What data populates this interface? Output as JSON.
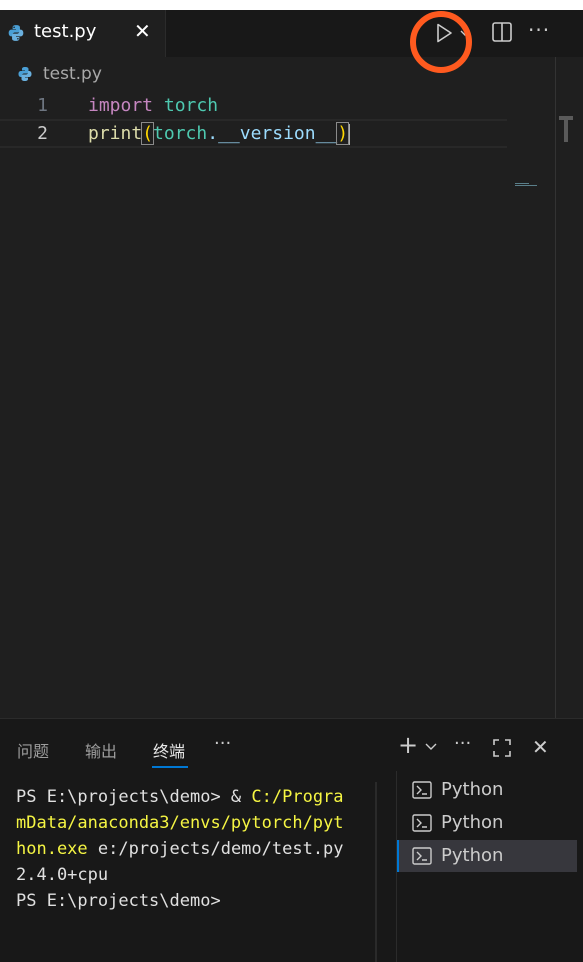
{
  "editor_tab": {
    "filename": "test.py",
    "close_glyph": "✕"
  },
  "toolbar": {
    "run_icon": "play-icon",
    "split_icon": "split-editor-icon",
    "more_glyph": "···"
  },
  "breadcrumb": {
    "file": "test.py"
  },
  "code": {
    "lines": [
      {
        "number": "1",
        "keyword": "import",
        "module": "torch"
      },
      {
        "number": "2",
        "func": "print",
        "open": "(",
        "obj": "torch",
        "dot": ".",
        "attr": "__version__",
        "close": ")"
      }
    ]
  },
  "panel": {
    "tabs": [
      "问题",
      "输出",
      "终端"
    ],
    "active_tab": "终端",
    "more_glyph": "···",
    "add_glyph": "+",
    "close_glyph": "✕"
  },
  "terminal": {
    "lines": [
      {
        "prefix": "PS E:\\projects\\demo> & ",
        "highlight": "C:/Progra"
      },
      {
        "highlight": "mData/anaconda3/envs/pytorch/pyt"
      },
      {
        "highlight": "hon.exe",
        "suffix": " e:/projects/demo/test.py"
      },
      {
        "text": "2.4.0+cpu"
      },
      {
        "text": "PS E:\\projects\\demo>"
      }
    ],
    "sessions": [
      "Python",
      "Python",
      "Python"
    ],
    "active_session": 2
  },
  "colors": {
    "accent": "#0078d4",
    "highlight_ring": "#ff5a1f",
    "keyword": "#c586c0",
    "module": "#4ec9b0",
    "function": "#dcdcaa",
    "bracket": "#ffd700",
    "variable": "#9cdcfe",
    "terminal_path": "#f5f543"
  }
}
